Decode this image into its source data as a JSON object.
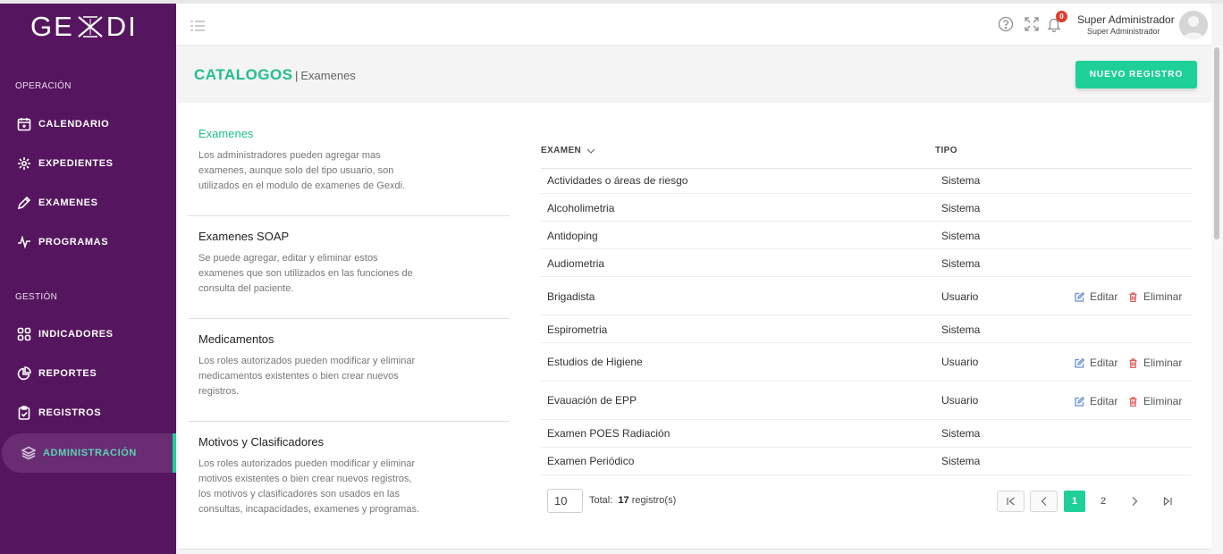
{
  "app": {
    "logo_left": "GE",
    "logo_right": "DI"
  },
  "sidebar": {
    "sections": [
      {
        "label": "OPERACIÓN"
      },
      {
        "label": "GESTIÓN"
      }
    ],
    "items": [
      {
        "label": "CALENDARIO",
        "icon": "calendar-icon"
      },
      {
        "label": "EXPEDIENTES",
        "icon": "folder-group-icon"
      },
      {
        "label": "EXAMENES",
        "icon": "pencil-icon"
      },
      {
        "label": "PROGRAMAS",
        "icon": "pulse-icon"
      },
      {
        "label": "INDICADORES",
        "icon": "grid-icon"
      },
      {
        "label": "REPORTES",
        "icon": "pie-chart-icon"
      },
      {
        "label": "REGISTROS",
        "icon": "clipboard-icon"
      },
      {
        "label": "ADMINISTRACIÓN",
        "icon": "layers-icon",
        "active": true
      }
    ]
  },
  "header": {
    "notifications_count": "0",
    "user_name": "Super Administrador",
    "user_role": "Super Administrador"
  },
  "page": {
    "title": "CATALOGOS",
    "separator": "|",
    "subtitle": "Examenes",
    "new_button": "NUEVO REGISTRO"
  },
  "catalogs": [
    {
      "title": "Examenes",
      "active": true,
      "description": "Los administradores pueden agregar mas examenes, aunque solo del tipo usuario, son utilizados en el modulo de examenes de Gexdi."
    },
    {
      "title": "Examenes SOAP",
      "description": "Se puede agregar, editar y eliminar estos examenes que son utilizados en las funciones de consulta del paciente."
    },
    {
      "title": "Medicamentos",
      "description": "Los roles autorizados pueden modificar y eliminar medicamentos existentes o bien crear nuevos registros."
    },
    {
      "title": "Motivos y Clasificadores",
      "description": "Los roles autorizados pueden modificar y eliminar motivos existentes o bien crear nuevos registros, los motivos y clasificadores son usados en las consultas, incapacidades, examenes y programas."
    }
  ],
  "table": {
    "columns": [
      "EXAMEN",
      "TIPO"
    ],
    "edit_label": "Editar",
    "delete_label": "Eliminar",
    "rows": [
      {
        "name": "Actividades o áreas de riesgo",
        "tipo": "Sistema"
      },
      {
        "name": "Alcoholimetria",
        "tipo": "Sistema"
      },
      {
        "name": "Antidoping",
        "tipo": "Sistema"
      },
      {
        "name": "Audiometria",
        "tipo": "Sistema"
      },
      {
        "name": "Brigadista",
        "tipo": "Usuario"
      },
      {
        "name": "Espirometria",
        "tipo": "Sistema"
      },
      {
        "name": "Estudios de Higiene",
        "tipo": "Usuario"
      },
      {
        "name": "Evauación de EPP",
        "tipo": "Usuario"
      },
      {
        "name": "Examen POES Radiación",
        "tipo": "Sistema"
      },
      {
        "name": "Examen Periódico",
        "tipo": "Sistema"
      }
    ]
  },
  "pagination": {
    "page_size": "10",
    "total_label": "Total:",
    "total_count": "17",
    "total_suffix": "registro(s)",
    "pages": [
      "1",
      "2"
    ],
    "current": "1"
  },
  "colors": {
    "sidebar": "#56165f",
    "accent": "#1fcf98",
    "badge": "#e23d2b"
  }
}
